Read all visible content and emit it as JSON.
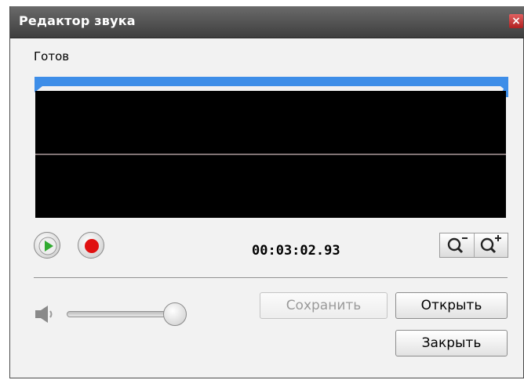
{
  "window": {
    "title": "Редактор звука",
    "close_glyph": "×"
  },
  "status": "Готов",
  "playback": {
    "time": "00:03:02.93"
  },
  "buttons": {
    "save": "Сохранить",
    "open": "Открыть",
    "close": "Закрыть"
  },
  "volume": {
    "level": 0.92
  },
  "icons": [
    "close-icon",
    "play-icon",
    "record-icon",
    "zoom-out-icon",
    "zoom-in-icon",
    "speaker-icon"
  ],
  "colors": {
    "wave": "#ff3b45",
    "timeline": "#3e8ee8",
    "play": "#2faa2f",
    "record": "#e01010"
  }
}
